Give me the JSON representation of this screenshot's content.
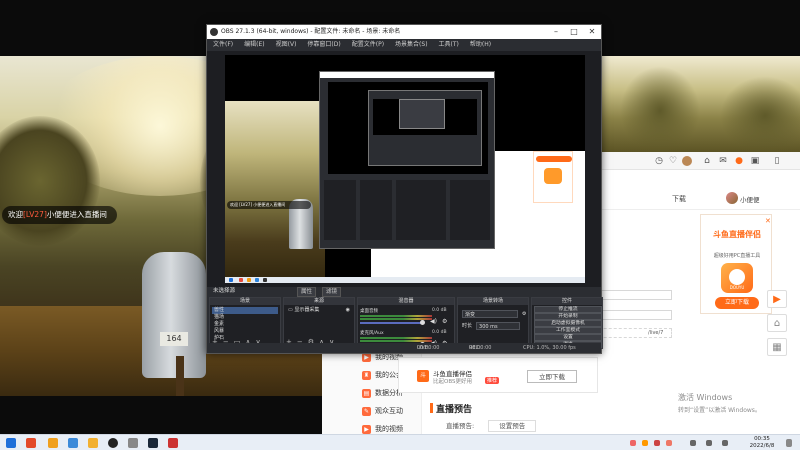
{
  "stream": {
    "welcome_prefix": "欢迎",
    "welcome_name": "[LV27]",
    "welcome_suffix": "小便便进入直播间",
    "mailbox_number": "164"
  },
  "obs": {
    "title": "OBS 27.1.3 (64-bit, windows) - 配置文件: 未命名 - 场景: 未命名",
    "menu": [
      "文件(F)",
      "编辑(E)",
      "视图(V)",
      "停靠窗口(D)",
      "配置文件(P)",
      "场景集合(S)",
      "工具(T)",
      "帮助(H)"
    ],
    "no_source_label": "未选择源",
    "attr_btn": "属性",
    "filter_btn": "滤镜",
    "docks": {
      "scenes": {
        "header": "场景",
        "items": [
          "兽性",
          "猫场",
          "金素",
          "风暴",
          "炉石",
          "迅战"
        ],
        "selected": 0
      },
      "sources": {
        "header": "来源",
        "items": [
          "显示器采集"
        ]
      },
      "mixer": {
        "header": "混音器",
        "rows": [
          {
            "name": "桌面音频",
            "db": "0.0 dB"
          },
          {
            "name": "麦克风/Aux",
            "db": "0.0 dB"
          }
        ]
      },
      "transitions": {
        "header": "场景转场",
        "mode": "渐变",
        "duration_label": "时长",
        "duration": "300 ms"
      },
      "controls": {
        "header": "控件",
        "buttons": [
          "停止推流",
          "开始录制",
          "启动虚拟摄像机",
          "工作室模式",
          "设置",
          "退出"
        ]
      }
    },
    "status": {
      "live_label": "LIVE:",
      "live_time": "00:00:00",
      "rec_label": "REC:",
      "rec_time": "00:00:00",
      "cpu": "CPU: 1.0%, 30.00 fps"
    },
    "preview_bubble": "欢迎 [LV27] 小便便进入直播间"
  },
  "web": {
    "download_link": "下载",
    "username": "小便便",
    "side_items": [
      "我的视频",
      "我的公会",
      "数据分析",
      "观众互动",
      "我的视频"
    ],
    "partner": {
      "title": "斗鱼直播伴侣",
      "sub": "比起OBS更好用",
      "tag": "推荐",
      "button": "立即下载"
    },
    "preview_title": "直播预告",
    "preview_label": "直播预告:",
    "preview_btn": "设置预告",
    "url_snippet": "/live/7",
    "promo": {
      "title": "斗鱼直播伴侣",
      "sub": "超级好用PC直播工具",
      "app_name": "DOUYU",
      "button": "立即下载"
    },
    "activate_line1": "激活 Windows",
    "activate_line2": "转到“设置”以激活 Windows。"
  },
  "taskbar": {
    "time": "00:35",
    "date": "2022/6/8"
  },
  "colors": {
    "accent": "#ff6a18",
    "obs_bg": "#2b2d32",
    "selected_scene": "#3d5b8a"
  }
}
